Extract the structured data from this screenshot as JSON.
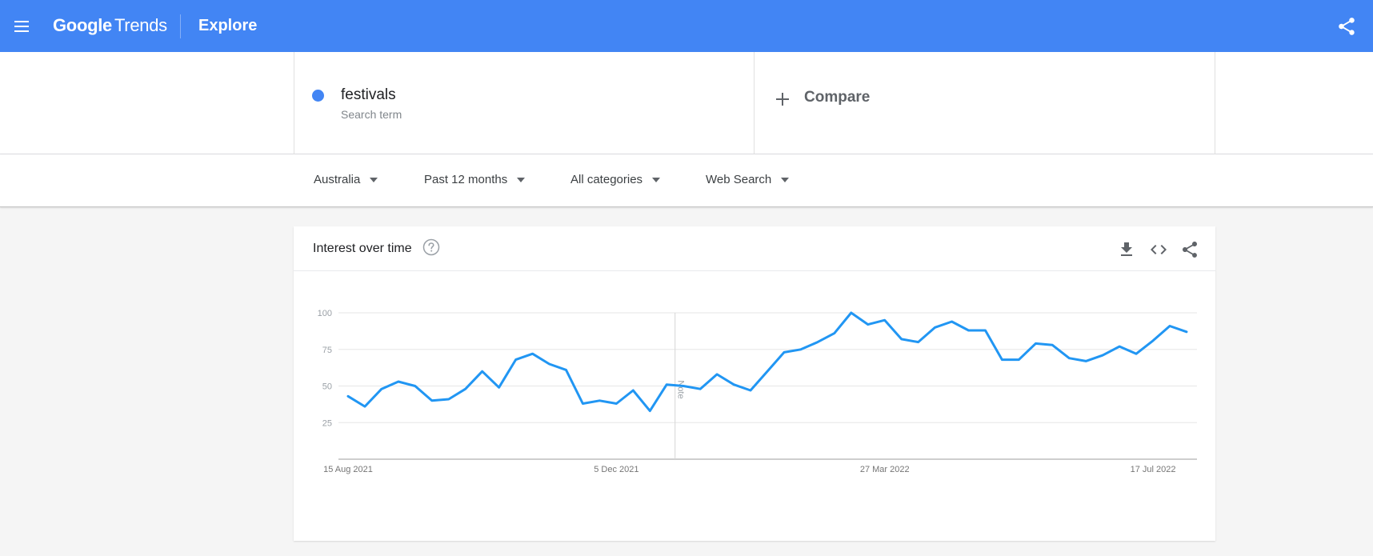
{
  "header": {
    "logo_google": "Google",
    "logo_trends": "Trends",
    "nav_title": "Explore"
  },
  "term": {
    "name": "festivals",
    "type": "Search term",
    "color": "#4285f4"
  },
  "compare": {
    "label": "Compare"
  },
  "filters": {
    "region": "Australia",
    "period": "Past 12 months",
    "category": "All categories",
    "property": "Web Search"
  },
  "card": {
    "title": "Interest over time"
  },
  "icons": {
    "menu": "menu-icon",
    "share": "share-icon",
    "help": "help-icon",
    "download": "download-icon",
    "embed": "embed-icon"
  },
  "chart_data": {
    "type": "line",
    "title": "Interest over time",
    "xlabel": "",
    "ylabel": "",
    "ylim": [
      0,
      100
    ],
    "yticks": [
      25,
      50,
      75,
      100
    ],
    "xtick_labels": [
      "15 Aug 2021",
      "5 Dec 2021",
      "27 Mar 2022",
      "17 Jul 2022"
    ],
    "xtick_indices": [
      0,
      16,
      32,
      48
    ],
    "note": {
      "label": "Note",
      "index": 19.5
    },
    "grid": true,
    "color": "#2196f3",
    "series": [
      {
        "name": "festivals",
        "values": [
          43,
          36,
          48,
          53,
          50,
          40,
          41,
          48,
          60,
          49,
          68,
          72,
          65,
          61,
          38,
          40,
          38,
          47,
          33,
          51,
          50,
          48,
          58,
          51,
          47,
          60,
          73,
          75,
          80,
          86,
          100,
          92,
          95,
          82,
          80,
          90,
          94,
          88,
          88,
          68,
          68,
          79,
          78,
          69,
          67,
          71,
          77,
          72,
          81,
          91,
          87
        ]
      }
    ]
  }
}
